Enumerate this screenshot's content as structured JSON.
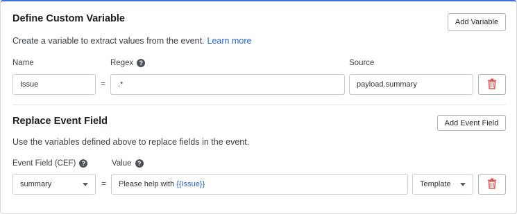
{
  "section1": {
    "title": "Define Custom Variable",
    "add_button": "Add Variable",
    "description": "Create a variable to extract values from the event.",
    "learn_more": "Learn more",
    "labels": {
      "name": "Name",
      "regex": "Regex",
      "source": "Source"
    },
    "help_glyph": "?",
    "equals": "=",
    "name_value": "Issue",
    "regex_value": ".*",
    "source_value": "payload.summary",
    "delete_icon": "trash-icon"
  },
  "section2": {
    "title": "Replace Event Field",
    "add_button": "Add Event Field",
    "description": "Use the variables defined above to replace fields in the event.",
    "labels": {
      "event_field": "Event Field (CEF)",
      "value": "Value"
    },
    "help_glyph": "?",
    "equals": "=",
    "event_field_value": "summary",
    "value_prefix": "Please help with ",
    "value_variable": "{{Issue}}",
    "type_value": "Template",
    "delete_icon": "trash-icon"
  },
  "colors": {
    "accent": "#3d6fd8",
    "link": "#1f63d6",
    "delete": "#d9534f",
    "variable": "#2a63c9"
  }
}
